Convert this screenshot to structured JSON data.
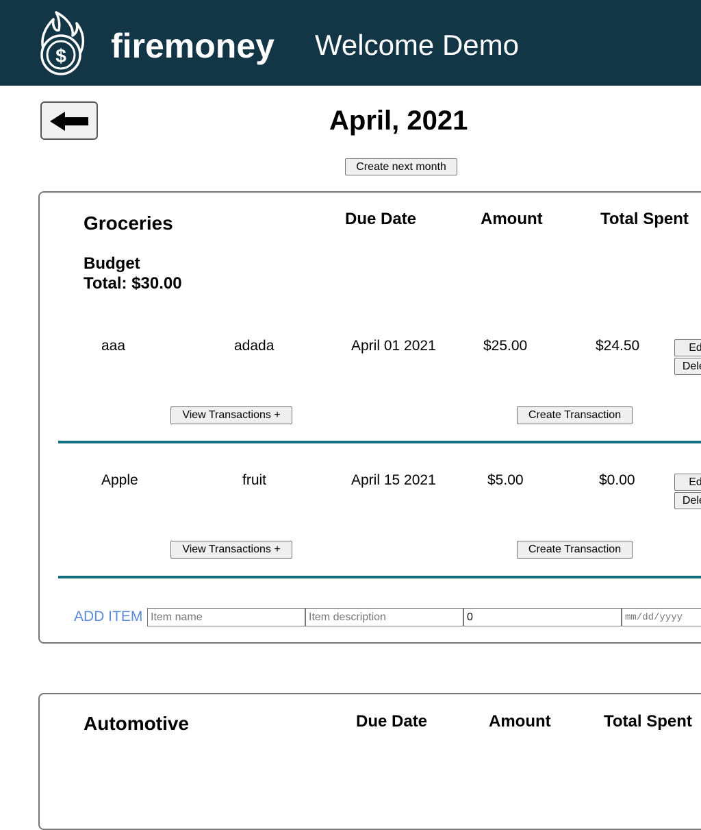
{
  "header": {
    "brand": "firemoney",
    "welcome": "Welcome Demo",
    "logo_icon": "flame-dollar-coin-icon",
    "background": "#133646"
  },
  "back_button": {
    "icon": "arrow-left-icon"
  },
  "month": {
    "title": "April, 2021",
    "create_next_label": "Create next month"
  },
  "category": {
    "name": "Groceries",
    "budget_label": "Budget",
    "budget_total": "Total: $30.00",
    "columns": {
      "due_date": "Due Date",
      "amount": "Amount",
      "total_spent": "Total Spent"
    },
    "items": [
      {
        "name": "aaa",
        "description": "adada",
        "due_date": "April 01 2021",
        "amount": "$25.00",
        "total_spent": "$24.50",
        "edit_label": "Edit",
        "delete_label": "Delete",
        "view_label": "View Transactions +",
        "create_label": "Create Transaction"
      },
      {
        "name": "Apple",
        "description": "fruit",
        "due_date": "April 15 2021",
        "amount": "$5.00",
        "total_spent": "$0.00",
        "edit_label": "Edit",
        "delete_label": "Delete",
        "view_label": "View Transactions +",
        "create_label": "Create Transaction"
      }
    ],
    "add_item": {
      "label": "ADD ITEM",
      "name_placeholder": "Item name",
      "description_placeholder": "Item description",
      "amount_value": "0",
      "date_placeholder": "mm/dd/yyyy"
    }
  },
  "category2": {
    "name": "Automotive",
    "columns": {
      "due_date": "Due Date",
      "amount": "Amount",
      "total_spent": "Total Spent"
    }
  },
  "colors": {
    "divider": "#14707f",
    "add_item": "#5b8ad6"
  }
}
